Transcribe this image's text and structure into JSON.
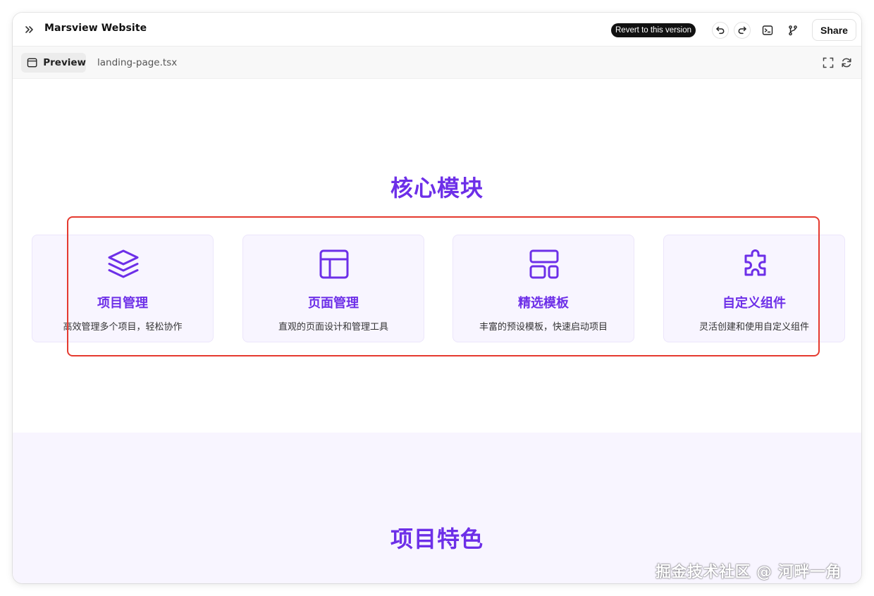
{
  "header": {
    "app_title": "Marsview Website",
    "revert_label": "Revert to this version",
    "share_label": "Share"
  },
  "tabs": {
    "preview_label": "Preview",
    "file_label": "landing-page.tsx"
  },
  "core": {
    "title": "核心模块",
    "cards": [
      {
        "title": "项目管理",
        "desc": "高效管理多个项目，轻松协作",
        "icon": "layers-icon"
      },
      {
        "title": "页面管理",
        "desc": "直观的页面设计和管理工具",
        "icon": "layout-icon"
      },
      {
        "title": "精选模板",
        "desc": "丰富的预设模板，快速启动项目",
        "icon": "template-icon"
      },
      {
        "title": "自定义组件",
        "desc": "灵活创建和使用自定义组件",
        "icon": "puzzle-icon"
      }
    ]
  },
  "features": {
    "title": "项目特色"
  },
  "watermark": "掘金技术社区 @ 河畔一角",
  "colors": {
    "accent": "#6d2fe8",
    "card_bg": "#f8f5ff",
    "highlight": "#e53a2f"
  }
}
